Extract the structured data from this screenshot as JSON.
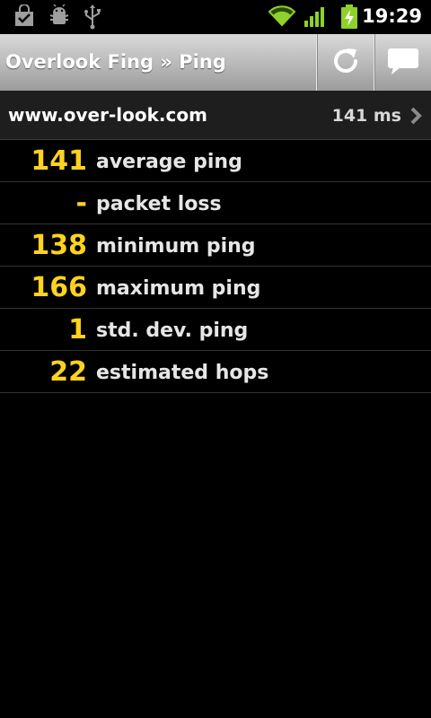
{
  "status_bar": {
    "time": "19:29",
    "icons": [
      "shopping-bag-icon",
      "android-debug-icon",
      "usb-icon",
      "wifi-icon",
      "signal-icon",
      "battery-charging-icon"
    ]
  },
  "title_bar": {
    "title": "Overlook Fing » Ping",
    "actions": [
      "refresh-icon",
      "comment-icon"
    ]
  },
  "host": {
    "name": "www.over-look.com",
    "time": "141 ms"
  },
  "stats": [
    {
      "value": "141",
      "label": "average ping"
    },
    {
      "value": "-",
      "label": "packet loss"
    },
    {
      "value": "138",
      "label": "minimum ping"
    },
    {
      "value": "166",
      "label": "maximum ping"
    },
    {
      "value": "1",
      "label": "std. dev. ping"
    },
    {
      "value": "22",
      "label": "estimated hops"
    }
  ],
  "colors": {
    "accent": "#ffd21f",
    "background": "#000000",
    "title_bar": "#b8b8b8",
    "wifi": "#8ed12a"
  }
}
